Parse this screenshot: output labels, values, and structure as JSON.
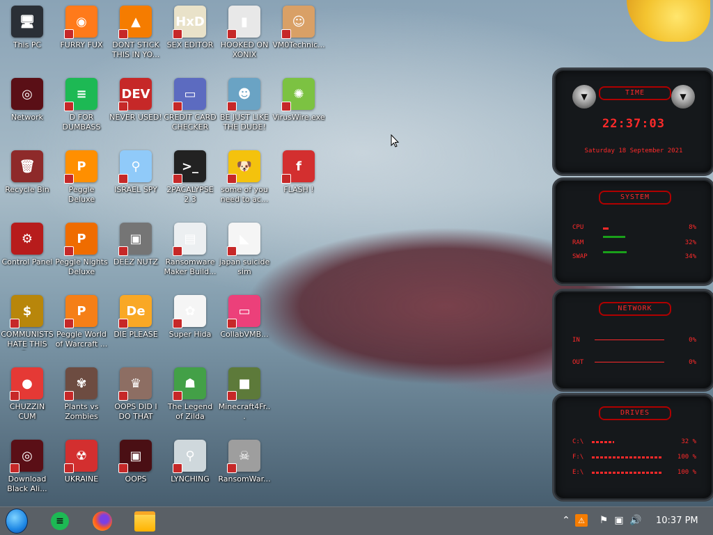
{
  "desktop": {
    "icons": [
      {
        "label": "This PC",
        "bg": "#2a2f36",
        "glyph": "🖥"
      },
      {
        "label": "FURRY FUX",
        "bg": "#ff7a1a",
        "glyph": "◉"
      },
      {
        "label": "DONT STICK THIS IN YO...",
        "bg": "#f57c00",
        "glyph": "▲"
      },
      {
        "label": "SEX EDITOR",
        "bg": "#e9e2c9",
        "glyph": "HxD"
      },
      {
        "label": "HOOKED ON XONIX",
        "bg": "#e8e8e8",
        "glyph": "▮"
      },
      {
        "label": "VM0Technic...",
        "bg": "#d9a066",
        "glyph": "☺"
      },
      {
        "label": "Network",
        "bg": "#5a0f16",
        "glyph": "◎"
      },
      {
        "label": "D FOR DUMBASS",
        "bg": "#1db954",
        "glyph": "≡"
      },
      {
        "label": "NEVER USED!",
        "bg": "#c62828",
        "glyph": "DEV"
      },
      {
        "label": "CREDIT CARD CHECKER",
        "bg": "#5c6bc0",
        "glyph": "▭"
      },
      {
        "label": "BE JUST LIKE THE DUDE!",
        "bg": "#6aa3c4",
        "glyph": "☻"
      },
      {
        "label": "VirusWire.exe",
        "bg": "#7cc242",
        "glyph": "✺"
      },
      {
        "label": "Recycle Bin",
        "bg": "#8e2a2a",
        "glyph": "🗑"
      },
      {
        "label": "Peggle Deluxe",
        "bg": "#ff8f00",
        "glyph": "P"
      },
      {
        "label": "ISRAEL SPY",
        "bg": "#90caf9",
        "glyph": "⚲"
      },
      {
        "label": "2PACALYPSE 2.3",
        "bg": "#222",
        "glyph": ">_"
      },
      {
        "label": "some of you need to ac...",
        "bg": "#f4c20d",
        "glyph": "🐶"
      },
      {
        "label": "FLASH !",
        "bg": "#d32f2f",
        "glyph": "f"
      },
      {
        "label": "Control Panel",
        "bg": "#b71c1c",
        "glyph": "⚙"
      },
      {
        "label": "Peggle Nights Deluxe",
        "bg": "#ef6c00",
        "glyph": "P"
      },
      {
        "label": "DEEZ NUTZ",
        "bg": "#757575",
        "glyph": "▣"
      },
      {
        "label": "Ransomware Maker Build...",
        "bg": "#eceff1",
        "glyph": "▤"
      },
      {
        "label": "japan suicide sim",
        "bg": "#f5f5f5",
        "glyph": "◣"
      },
      {
        "label": "COMMUNISTS HATE THIS G...",
        "bg": "#b8860b",
        "glyph": "$"
      },
      {
        "label": "Peggle World of Warcraft ...",
        "bg": "#f57f17",
        "glyph": "P"
      },
      {
        "label": "DIE PLEASE",
        "bg": "#f9a825",
        "glyph": "De"
      },
      {
        "label": "Super Hida",
        "bg": "#f5f5f5",
        "glyph": "✿"
      },
      {
        "label": "CollabVMB...",
        "bg": "#ec407a",
        "glyph": "▭"
      },
      {
        "label": "CHUZZIN CUM",
        "bg": "#e53935",
        "glyph": "●"
      },
      {
        "label": "Plants vs Zombies",
        "bg": "#6d4c41",
        "glyph": "✾"
      },
      {
        "label": "OOPS DID I DO THAT",
        "bg": "#8d6e63",
        "glyph": "♛"
      },
      {
        "label": "The Legend of Zilda",
        "bg": "#43a047",
        "glyph": "☗"
      },
      {
        "label": "Minecraft4Fr...",
        "bg": "#5d7a3a",
        "glyph": "■"
      },
      {
        "label": "Download Black Ali...",
        "bg": "#5a0f16",
        "glyph": "◎"
      },
      {
        "label": "UKRAINE",
        "bg": "#d32f2f",
        "glyph": "☢"
      },
      {
        "label": "OOPS",
        "bg": "#4a0f14",
        "glyph": "▣"
      },
      {
        "label": "LYNCHING",
        "bg": "#cfd8dc",
        "glyph": "⚲"
      },
      {
        "label": "RansomWar...",
        "bg": "#9e9e9e",
        "glyph": "☠"
      }
    ]
  },
  "widget": {
    "time_title": "TIME",
    "time": "22:37:03",
    "date": "Saturday 18 September 2021",
    "system_title": "SYSTEM",
    "cpu_label": "CPU",
    "cpu_value": "8%",
    "cpu_fill": 0.08,
    "ram_label": "RAM",
    "ram_value": "32%",
    "ram_fill": 0.32,
    "swap_label": "SWAP",
    "swap_value": "34%",
    "swap_fill": 0.34,
    "network_title": "NETWORK",
    "in_label": "IN",
    "in_value": "0%",
    "out_label": "OUT",
    "out_value": "0%",
    "drives_title": "DRIVES",
    "drive_c_label": "C:\\",
    "drive_c_value": "32 %",
    "drive_c_fill": 0.32,
    "drive_f_label": "F:\\",
    "drive_f_value": "100 %",
    "drive_f_fill": 1.0,
    "drive_e_label": "E:\\",
    "drive_e_value": "100 %",
    "drive_e_fill": 1.0
  },
  "taskbar": {
    "clock": "10:37 PM",
    "pinned": [
      "start-orb-icon",
      "notes-app-icon",
      "firefox-icon",
      "file-explorer-icon"
    ]
  },
  "colors": {
    "accent_red": "#ff2a2a",
    "green": "#1aa01a",
    "taskbar": "#5a6066"
  }
}
